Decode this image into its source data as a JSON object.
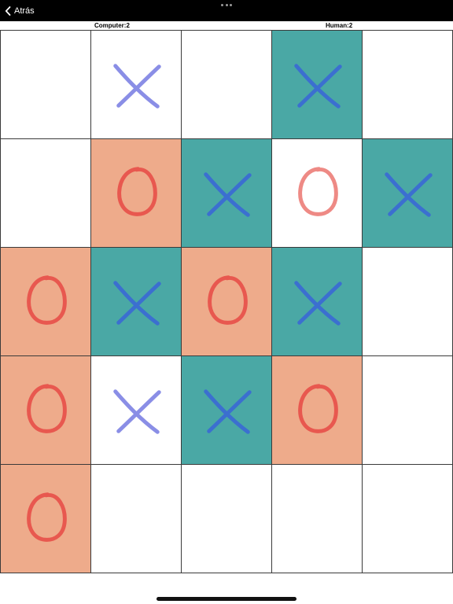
{
  "header": {
    "back_label": "Atrás"
  },
  "scores": {
    "computer": "Computer:2",
    "human": "Human:2"
  },
  "colors": {
    "x_highlight_bg": "#4aa8a5",
    "o_highlight_bg": "#eeab8b",
    "x_light": "#8a8ee6",
    "x_dark": "#3b6fd0",
    "o_red": "#e8584f",
    "o_pink": "#ee8a85"
  },
  "board": {
    "rows": 5,
    "cols": 5,
    "cells": [
      [
        {
          "mark": "",
          "bg": "white"
        },
        {
          "mark": "X",
          "bg": "white",
          "tone": "light"
        },
        {
          "mark": "",
          "bg": "white"
        },
        {
          "mark": "X",
          "bg": "teal",
          "tone": "dark"
        },
        {
          "mark": "",
          "bg": "white"
        }
      ],
      [
        {
          "mark": "",
          "bg": "white"
        },
        {
          "mark": "O",
          "bg": "salmon",
          "tone": "red"
        },
        {
          "mark": "X",
          "bg": "teal",
          "tone": "dark"
        },
        {
          "mark": "O",
          "bg": "white",
          "tone": "pink"
        },
        {
          "mark": "X",
          "bg": "teal",
          "tone": "dark"
        }
      ],
      [
        {
          "mark": "O",
          "bg": "salmon",
          "tone": "red"
        },
        {
          "mark": "X",
          "bg": "teal",
          "tone": "dark"
        },
        {
          "mark": "O",
          "bg": "salmon",
          "tone": "red"
        },
        {
          "mark": "X",
          "bg": "teal",
          "tone": "dark"
        },
        {
          "mark": "",
          "bg": "white"
        }
      ],
      [
        {
          "mark": "O",
          "bg": "salmon",
          "tone": "red"
        },
        {
          "mark": "X",
          "bg": "white",
          "tone": "light"
        },
        {
          "mark": "X",
          "bg": "teal",
          "tone": "dark"
        },
        {
          "mark": "O",
          "bg": "salmon",
          "tone": "red"
        },
        {
          "mark": "",
          "bg": "white"
        }
      ],
      [
        {
          "mark": "O",
          "bg": "salmon",
          "tone": "red"
        },
        {
          "mark": "",
          "bg": "white"
        },
        {
          "mark": "",
          "bg": "white"
        },
        {
          "mark": "",
          "bg": "white"
        },
        {
          "mark": "",
          "bg": "white"
        }
      ]
    ]
  }
}
